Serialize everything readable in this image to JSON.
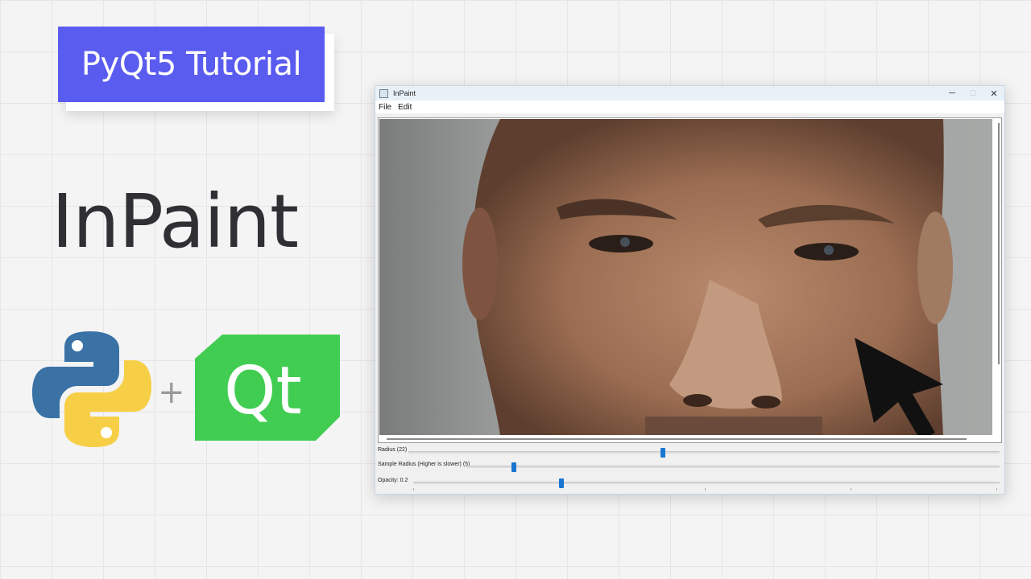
{
  "badge": {
    "text": "PyQt5 Tutorial"
  },
  "hero": {
    "title": "InPaint",
    "plus": "+",
    "qt_text": "Qt"
  },
  "colors": {
    "badge_bg": "#5a5cf0",
    "qt_green": "#41cd52",
    "python_blue": "#3a72a6",
    "python_yellow": "#f7cf47",
    "slider_handle": "#1976d2"
  },
  "window": {
    "title": "InPaint",
    "controls": {
      "minimize": "─",
      "maximize": "□",
      "close": "✕"
    },
    "menu": [
      "File",
      "Edit"
    ],
    "canvas": {
      "image": "close-up photo of a man's face with a large black mouse cursor"
    },
    "sliders": [
      {
        "label": "Radius (22)",
        "fraction": 0.43
      },
      {
        "label": "Sample Radius (Higher is slower) (5)",
        "fraction": 0.085
      },
      {
        "label": "Opacity: 0.2",
        "fraction": 0.25
      }
    ]
  }
}
